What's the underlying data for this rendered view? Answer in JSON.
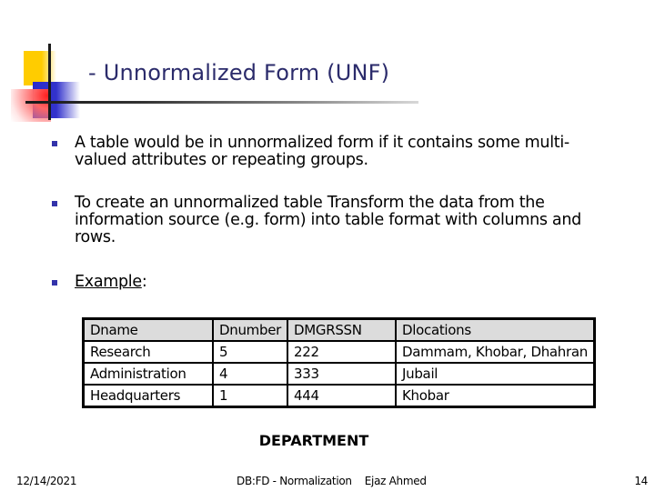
{
  "slide": {
    "title": "- Unnormalized Form  (UNF)",
    "bullets": [
      {
        "text": "A table would be in unnormalized form if it contains some multi-valued attributes or repeating groups."
      },
      {
        "text": "To create an unnormalized table  Transform the data from the information source (e.g. form) into table format with columns and rows."
      },
      {
        "text_underlined": "Example",
        "text_suffix": ":"
      }
    ],
    "table": {
      "headers": [
        "Dname",
        "Dnumber",
        "DMGRSSN",
        "Dlocations"
      ],
      "rows": [
        [
          "Research",
          "5",
          "222",
          "Dammam, Khobar, Dhahran"
        ],
        [
          "Administration",
          "4",
          "333",
          "Jubail"
        ],
        [
          "Headquarters",
          "1",
          "444",
          "Khobar"
        ]
      ],
      "caption": "DEPARTMENT"
    },
    "footer": {
      "date": "12/14/2021",
      "center": "DB:FD - Normalization    Ejaz Ahmed",
      "page_number": "14"
    },
    "colors": {
      "title": "#2b2b6b",
      "bullet": "#3333aa",
      "header_fill": "#dcdcdc"
    }
  }
}
